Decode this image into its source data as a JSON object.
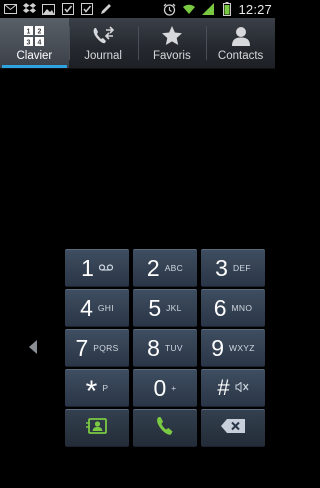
{
  "status_bar": {
    "time": "12:27",
    "left_icons": [
      "email-icon",
      "dropbox-icon",
      "photo-icon",
      "calendar-check-icon",
      "calendar-check-icon",
      "pen-icon"
    ],
    "right_icons": [
      "alarm-icon",
      "wifi-icon",
      "signal-icon",
      "battery-icon"
    ]
  },
  "tabs": [
    {
      "label": "Clavier",
      "icon": "keypad-icon",
      "active": true
    },
    {
      "label": "Journal",
      "icon": "call-log-icon",
      "active": false
    },
    {
      "label": "Favoris",
      "icon": "star-icon",
      "active": false
    },
    {
      "label": "Contacts",
      "icon": "contact-icon",
      "active": false
    }
  ],
  "keypad": {
    "keys": [
      {
        "digit": "1",
        "letters": "ᴑᴑ",
        "sub_icon": "voicemail-icon"
      },
      {
        "digit": "2",
        "letters": "ABC"
      },
      {
        "digit": "3",
        "letters": "DEF"
      },
      {
        "digit": "4",
        "letters": "GHI"
      },
      {
        "digit": "5",
        "letters": "JKL"
      },
      {
        "digit": "6",
        "letters": "MNO"
      },
      {
        "digit": "7",
        "letters": "PQRS"
      },
      {
        "digit": "8",
        "letters": "TUV"
      },
      {
        "digit": "9",
        "letters": "WXYZ"
      },
      {
        "digit": "*",
        "letters": "P"
      },
      {
        "digit": "0",
        "letters": "+"
      },
      {
        "digit": "#",
        "letters": "",
        "sub_icon": "mute-icon"
      }
    ],
    "function_keys": [
      "add-contact-icon",
      "phone-call-icon",
      "backspace-icon"
    ]
  },
  "colors": {
    "accent": "#2ea3e0",
    "call_green": "#7ac943",
    "key_bg": "#33414f"
  }
}
